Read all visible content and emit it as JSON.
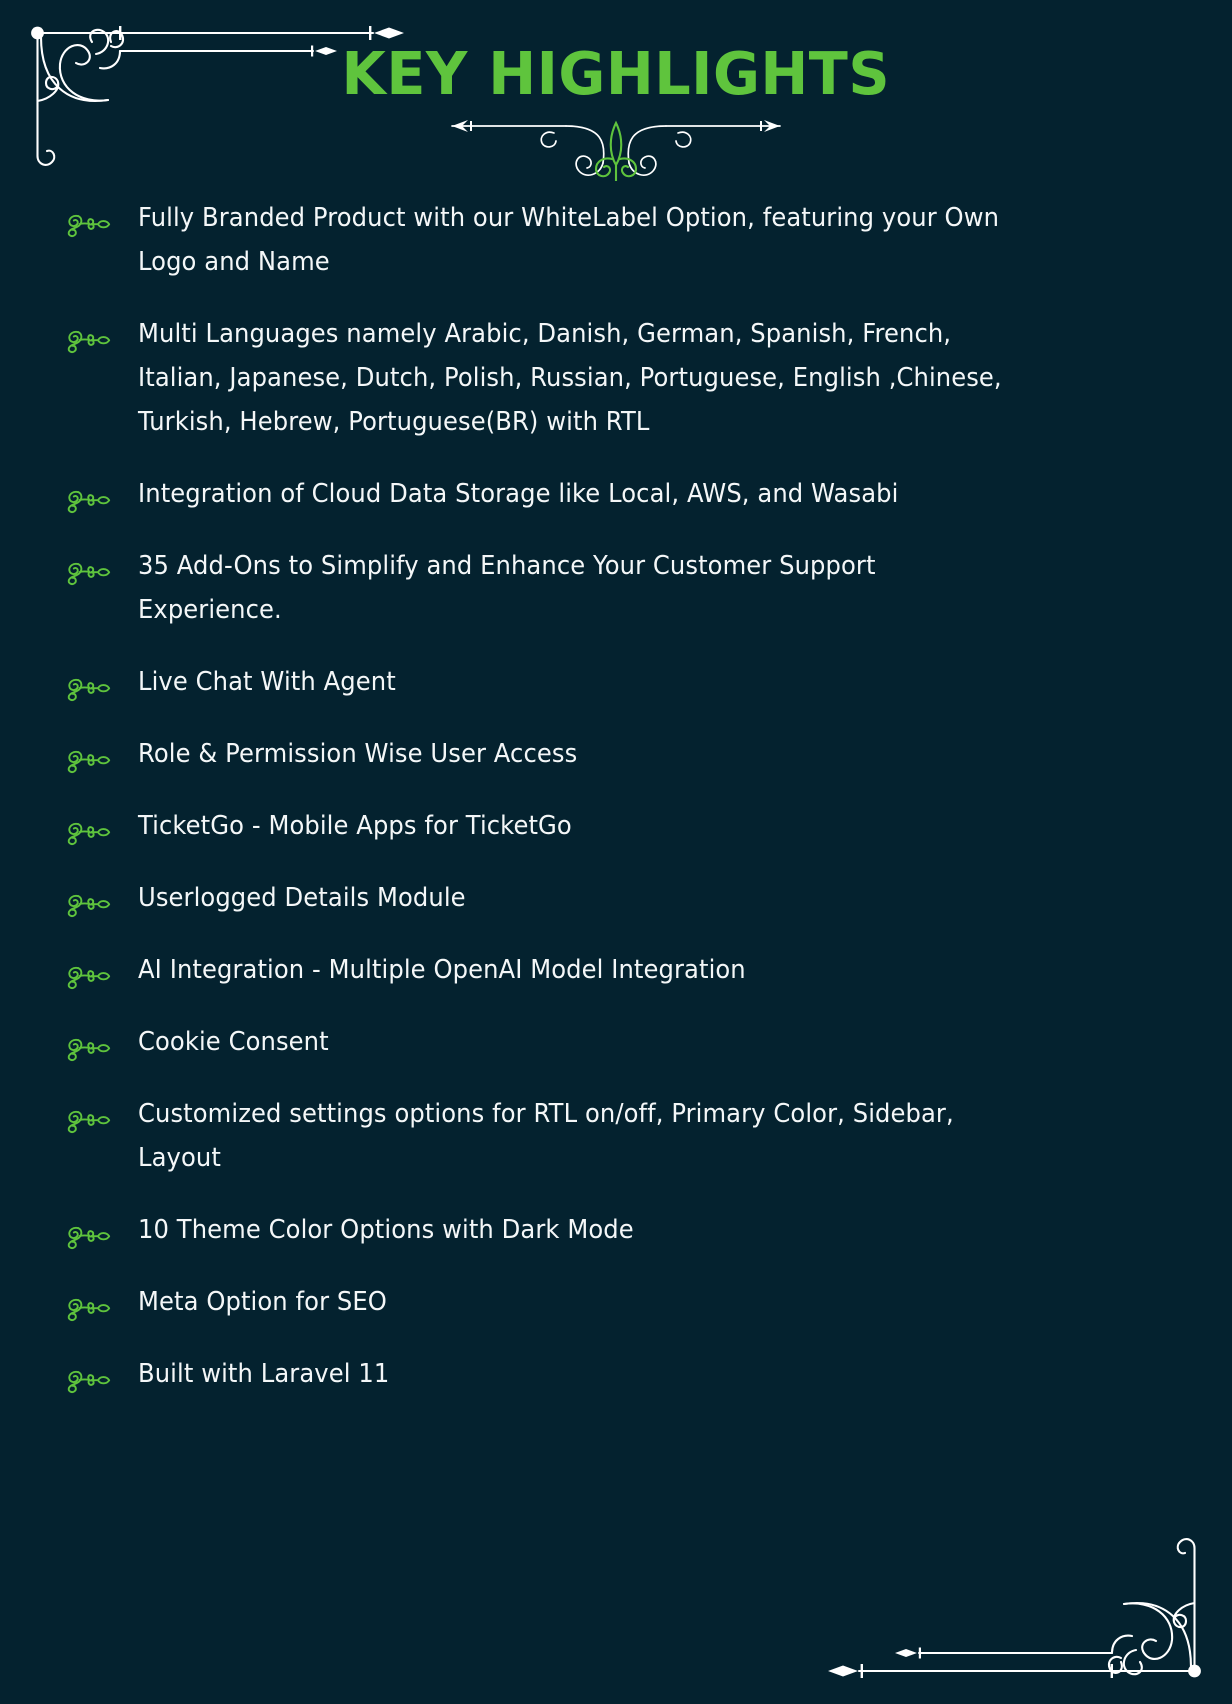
{
  "page": {
    "background_color": "#04222f",
    "accent_color": "#5fc43d",
    "text_color": "#f4f7f8",
    "ornament_color": "#ffffff"
  },
  "header": {
    "title": "KEY HIGHLIGHTS",
    "divider_icon": "fleur-de-lis-flourish-divider"
  },
  "ornaments": {
    "top_left": "corner-flourish-top-left",
    "bottom_right": "corner-flourish-bottom-right"
  },
  "highlights": {
    "bullet_icon": "ornamental-scroll-arrow-bullet",
    "items": [
      {
        "text": "Fully Branded Product with our WhiteLabel Option, featuring your Own Logo and Name"
      },
      {
        "text": "Multi Languages namely Arabic, Danish, German, Spanish, French, Italian, Japanese, Dutch, Polish, Russian, Portuguese, English ,Chinese, Turkish, Hebrew, Portuguese(BR) with RTL"
      },
      {
        "text": "Integration of Cloud Data Storage like Local, AWS, and Wasabi"
      },
      {
        "text": "35 Add-Ons to Simplify and Enhance Your Customer Support Experience."
      },
      {
        "text": "Live Chat With Agent"
      },
      {
        "text": "Role & Permission Wise User Access"
      },
      {
        "text": "TicketGo - Mobile Apps for TicketGo"
      },
      {
        "text": "Userlogged Details Module"
      },
      {
        "text": "AI Integration - Multiple OpenAI Model Integration"
      },
      {
        "text": "Cookie Consent"
      },
      {
        "text": "Customized settings options for RTL on/off, Primary Color, Sidebar, Layout"
      },
      {
        "text": "10 Theme Color Options with Dark Mode"
      },
      {
        "text": "Meta Option for SEO"
      },
      {
        "text": "Built with Laravel 11"
      }
    ]
  }
}
